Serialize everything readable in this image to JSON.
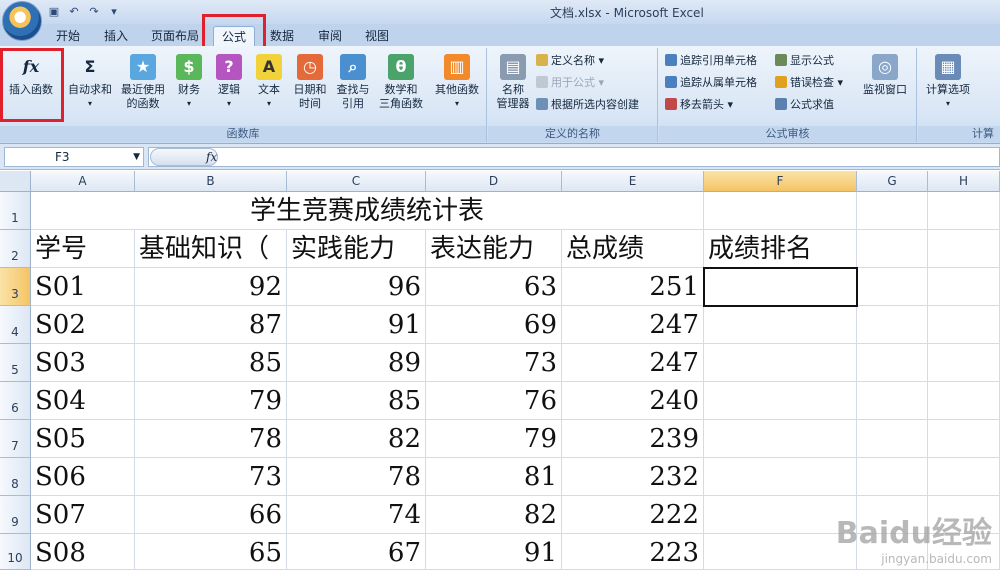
{
  "window": {
    "title": "文档.xlsx - Microsoft Excel"
  },
  "tabs": [
    "开始",
    "插入",
    "页面布局",
    "公式",
    "数据",
    "审阅",
    "视图"
  ],
  "active_tab": "公式",
  "ribbon": {
    "library": {
      "label": "函数库",
      "insert_function": "插入函数",
      "autosum": "自动求和",
      "recent_line1": "最近使用",
      "recent_line2": "的函数",
      "finance": "财务",
      "logic": "逻辑",
      "text": "文本",
      "datetime_line1": "日期和",
      "datetime_line2": "时间",
      "lookup_line1": "查找与",
      "lookup_line2": "引用",
      "math_line1": "数学和",
      "math_line2": "三角函数",
      "other": "其他函数"
    },
    "names": {
      "label": "定义的名称",
      "manager_line1": "名称",
      "manager_line2": "管理器",
      "define_name": "定义名称",
      "use_in_formula": "用于公式",
      "create_from_selection": "根据所选内容创建"
    },
    "audit": {
      "label": "公式审核",
      "trace_precedents": "追踪引用单元格",
      "trace_dependents": "追踪从属单元格",
      "remove_arrows": "移去箭头",
      "show_formulas": "显示公式",
      "error_check": "错误检查",
      "evaluate": "公式求值",
      "watch_window": "监视窗口"
    },
    "calc": {
      "label": "计算",
      "options": "计算选项"
    }
  },
  "formula_bar": {
    "name_box": "F3",
    "fx": "fx",
    "value": ""
  },
  "columns": [
    "A",
    "B",
    "C",
    "D",
    "E",
    "F",
    "G",
    "H"
  ],
  "rows": [
    "1",
    "2",
    "3",
    "4",
    "5",
    "6",
    "7",
    "8",
    "9",
    "10"
  ],
  "sheet": {
    "title": "学生竞赛成绩统计表",
    "headers": [
      "学号",
      "基础知识（",
      "实践能力",
      "表达能力",
      "总成绩",
      "成绩排名"
    ],
    "data": [
      [
        "S01",
        "92",
        "96",
        "63",
        "251"
      ],
      [
        "S02",
        "87",
        "91",
        "69",
        "247"
      ],
      [
        "S03",
        "85",
        "89",
        "73",
        "247"
      ],
      [
        "S04",
        "79",
        "85",
        "76",
        "240"
      ],
      [
        "S05",
        "78",
        "82",
        "79",
        "239"
      ],
      [
        "S06",
        "73",
        "78",
        "81",
        "232"
      ],
      [
        "S07",
        "66",
        "74",
        "82",
        "222"
      ],
      [
        "S08",
        "65",
        "67",
        "91",
        "223"
      ]
    ]
  },
  "watermark": {
    "brand": "Baidu经验",
    "url": "jingyan.baidu.com"
  },
  "colors": {
    "highlight": "#e0202a",
    "selected_header": "#f4c465",
    "ribbon": "#d9e6f5"
  }
}
